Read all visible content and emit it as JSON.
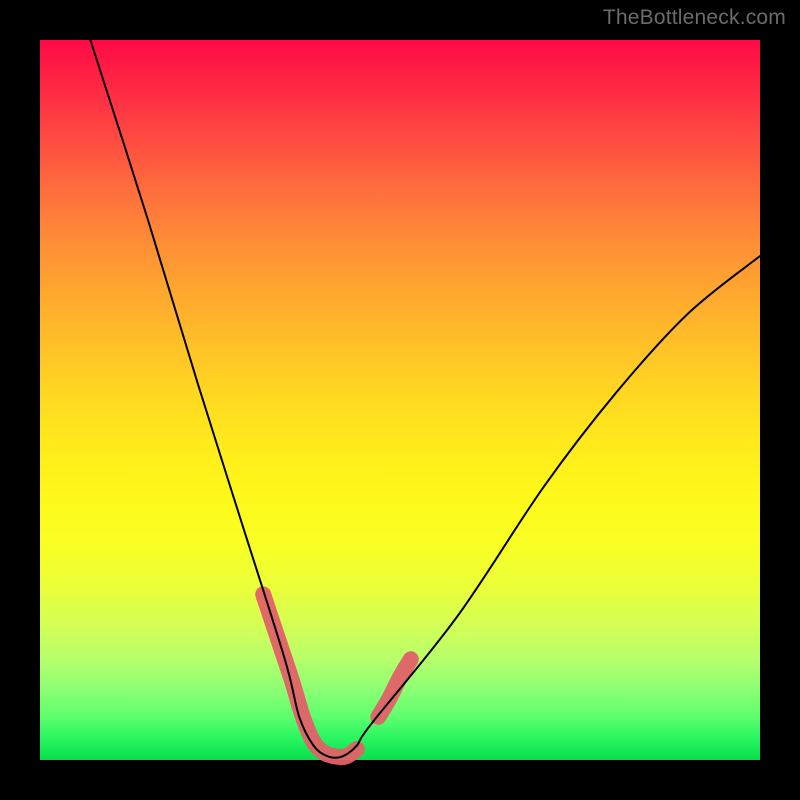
{
  "watermark": "TheBottleneck.com",
  "chart_data": {
    "type": "line",
    "title": "",
    "xlabel": "",
    "ylabel": "",
    "xlim": [
      0,
      100
    ],
    "ylim": [
      0,
      100
    ],
    "grid": false,
    "legend": false,
    "series": [
      {
        "name": "bottleneck_curve",
        "color": "#000000",
        "x": [
          7,
          15,
          22,
          28,
          34,
          36,
          38,
          40,
          42,
          44,
          46,
          58,
          70,
          80,
          90,
          100
        ],
        "y": [
          100,
          75,
          52,
          33,
          14,
          6,
          2,
          0.5,
          0.5,
          2,
          5,
          20,
          38,
          51,
          62,
          70
        ]
      },
      {
        "name": "highlight_segment_left",
        "color": "#e16168",
        "x": [
          31,
          33,
          35,
          36.5,
          38,
          39.5,
          41,
          42.5,
          44
        ],
        "y": [
          23,
          17,
          11,
          6,
          2.5,
          1,
          0.5,
          0.5,
          1.5
        ]
      },
      {
        "name": "highlight_segment_right",
        "color": "#e16168",
        "x": [
          47,
          48.5,
          50,
          51.5
        ],
        "y": [
          6,
          8.5,
          11.5,
          14
        ]
      }
    ],
    "background_gradient": {
      "direction": "vertical",
      "top": "#ff0a46",
      "bottom": "#07df4b"
    }
  }
}
